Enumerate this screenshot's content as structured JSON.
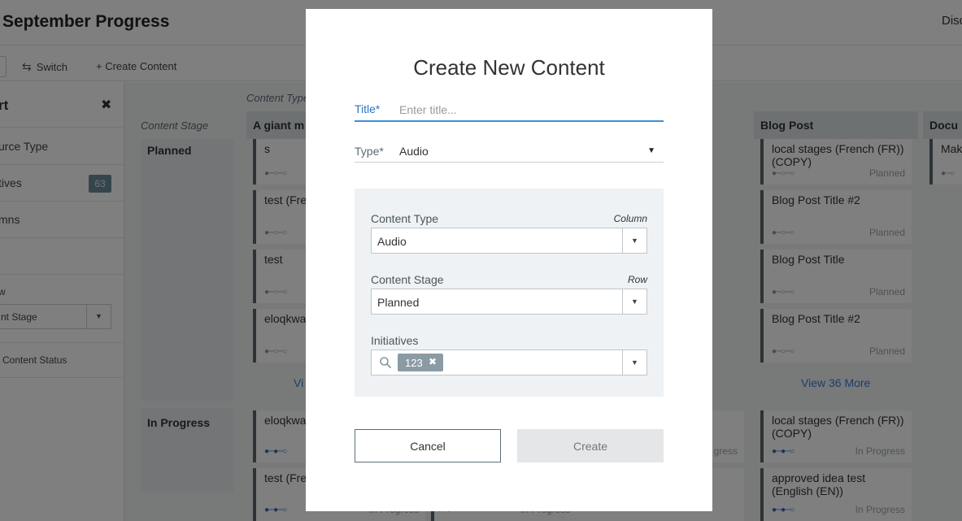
{
  "page": {
    "title": "September Progress",
    "top_right": "Disc"
  },
  "toolbar": {
    "switch_label": "Switch",
    "create_label": "+ Create Content"
  },
  "sidebar": {
    "title": "rt",
    "rows": [
      {
        "label": "urce Type"
      },
      {
        "label": "tives",
        "count": "63"
      },
      {
        "label": "mns"
      },
      {
        "label": ""
      }
    ],
    "small_label": "w",
    "select_value": "nt Stage",
    "status_label": "Content Status"
  },
  "board": {
    "content_type_label": "Content Type",
    "content_stage_label": "Content Stage",
    "columns": [
      "A giant m",
      "Blog Post",
      "Docu"
    ],
    "rows": [
      "Planned",
      "In Progress"
    ],
    "cards": [
      {
        "title": "s",
        "status": ""
      },
      {
        "title": "test (Fre",
        "status": ""
      },
      {
        "title": "test",
        "status": ""
      },
      {
        "title": "eloqkwa (SP))",
        "status": ""
      },
      {
        "title": "eloqkwa (SP)) (CC",
        "status": ""
      },
      {
        "title": "test (Fre",
        "status": "In Progress"
      },
      {
        "title": "local stages (French (FR)) (COPY)",
        "status": "Planned"
      },
      {
        "title": "Blog Post Title #2",
        "status": "Planned"
      },
      {
        "title": "Blog Post Title",
        "status": "Planned"
      },
      {
        "title": "Blog Post Title #2",
        "status": "Planned"
      },
      {
        "title": "local stages (French (FR)) (COPY)",
        "status": "In Progress"
      },
      {
        "title": "approved idea test (English (EN))",
        "status": "In Progress"
      },
      {
        "title": "Mak",
        "status": ""
      },
      {
        "title": "",
        "status": "In Progress"
      },
      {
        "title": "",
        "status": "gress"
      }
    ],
    "view_more_left": "Vi",
    "view_more_right": "View 36 More"
  },
  "modal": {
    "title": "Create New Content",
    "title_field": {
      "label": "Title*",
      "placeholder": "Enter title...",
      "value": ""
    },
    "type_field": {
      "label": "Type*",
      "value": "Audio"
    },
    "content_type": {
      "label": "Content Type",
      "hint": "Column",
      "value": "Audio"
    },
    "content_stage": {
      "label": "Content Stage",
      "hint": "Row",
      "value": "Planned"
    },
    "initiatives": {
      "label": "Initiatives",
      "tags": [
        "123"
      ]
    },
    "cancel_label": "Cancel",
    "create_label": "Create"
  }
}
